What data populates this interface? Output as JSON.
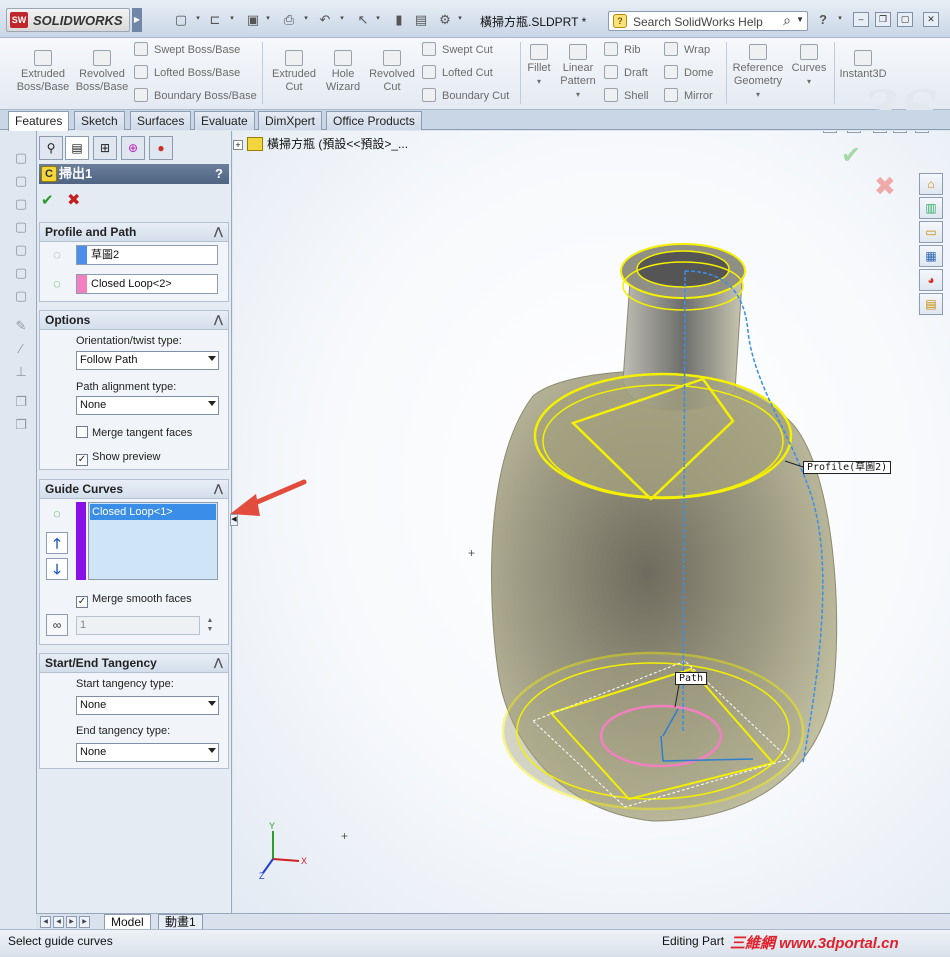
{
  "app": {
    "logo_text": "SOLIDWORKS",
    "logo_badge": "SW",
    "document_title": "橫掃方瓶.SLDPRT *",
    "search_placeholder": "Search SolidWorks Help",
    "help_label": "?"
  },
  "commands": {
    "extruded_boss": "Extruded Boss/Base",
    "revolved_boss": "Revolved Boss/Base",
    "swept_boss": "Swept Boss/Base",
    "lofted_boss": "Lofted Boss/Base",
    "boundary_boss": "Boundary Boss/Base",
    "extruded_cut": "Extruded Cut",
    "hole_wizard": "Hole Wizard",
    "revolved_cut": "Revolved Cut",
    "swept_cut": "Swept Cut",
    "lofted_cut": "Lofted Cut",
    "boundary_cut": "Boundary Cut",
    "fillet": "Fillet",
    "linear_pattern": "Linear Pattern",
    "rib": "Rib",
    "draft": "Draft",
    "shell": "Shell",
    "wrap": "Wrap",
    "dome": "Dome",
    "mirror": "Mirror",
    "reference_geometry": "Reference Geometry",
    "curves": "Curves",
    "instant3d": "Instant3D"
  },
  "tabs": [
    "Features",
    "Sketch",
    "Surfaces",
    "Evaluate",
    "DimXpert",
    "Office Products"
  ],
  "property_manager": {
    "title": "掃出1",
    "help": "?",
    "profile_path": {
      "heading": "Profile and Path",
      "profile_value": "草圖2",
      "path_value": "Closed Loop<2>"
    },
    "options": {
      "heading": "Options",
      "orientation_label": "Orientation/twist type:",
      "orientation_value": "Follow Path",
      "path_alignment_label": "Path alignment type:",
      "path_alignment_value": "None",
      "merge_tangent_label": "Merge tangent faces",
      "merge_tangent_checked": "",
      "show_preview_label": "Show preview",
      "show_preview_checked": "✓"
    },
    "guide_curves": {
      "heading": "Guide Curves",
      "items": [
        "Closed Loop<1>"
      ],
      "merge_smooth_label": "Merge smooth faces",
      "merge_smooth_checked": "✓",
      "spin_value": "1"
    },
    "tangency": {
      "heading": "Start/End Tangency",
      "start_label": "Start tangency type:",
      "start_value": "None",
      "end_label": "End tangency type:",
      "end_value": "None"
    }
  },
  "viewport": {
    "tree_root": "橫掃方瓶 (預設<<預設>_...",
    "profile_callout": "Profile(草圖2)",
    "path_callout": "Path",
    "axis_x": "X",
    "axis_y": "Y",
    "axis_z": "Z"
  },
  "bottom_tabs": [
    "Model",
    "動畫1"
  ],
  "status": {
    "message": "Select guide curves",
    "mode": "Editing Part",
    "watermark": "三維網 www.3dportal.cn"
  },
  "colors": {
    "profile_swatch": "#4b8fe8",
    "path_swatch": "#f27fbf",
    "guide_swatch": "#8a10e8",
    "highlight_yellow": "#f4f000",
    "arrow_red": "#e24c3c"
  }
}
